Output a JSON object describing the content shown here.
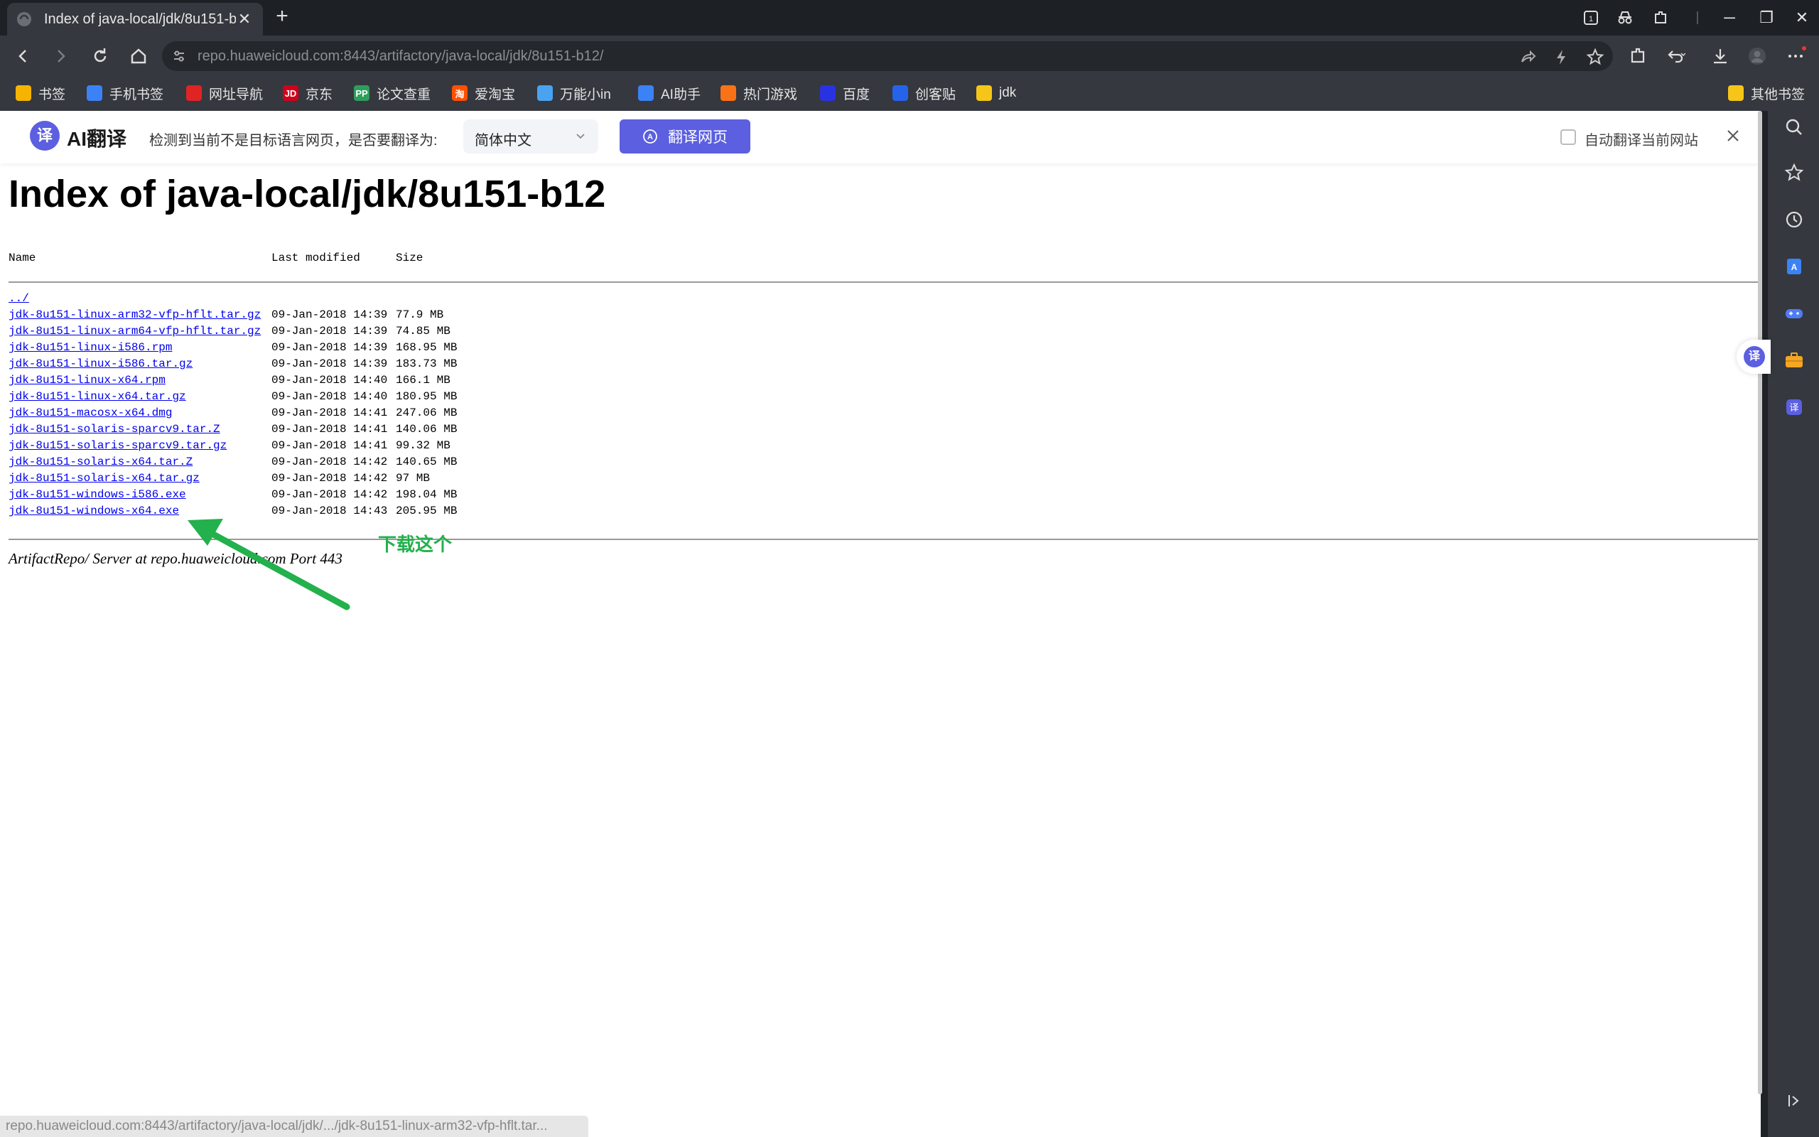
{
  "browser": {
    "tab_title": "Index of java-local/jdk/8u151-b",
    "url": "repo.huaweicloud.com:8443/artifactory/java-local/jdk/8u151-b12/",
    "status_url": "repo.huaweicloud.com:8443/artifactory/java-local/jdk/.../jdk-8u151-linux-arm32-vfp-hflt.tar..."
  },
  "bookmarks": [
    {
      "label": "书签",
      "icon": "star-icon",
      "color": "#f5b400"
    },
    {
      "label": "手机书签",
      "icon": "phone-bookmark-icon",
      "color": "#3b82f6"
    },
    {
      "label": "网址导航",
      "icon": "nav-site-icon",
      "color": "#e02424"
    },
    {
      "label": "京东",
      "icon": "jd-icon",
      "color": "#d0021b",
      "glyph": "JD"
    },
    {
      "label": "论文查重",
      "icon": "paper-check-icon",
      "color": "#2e9e5b",
      "glyph": "PP"
    },
    {
      "label": "爱淘宝",
      "icon": "taobao-icon",
      "color": "#ff5000",
      "glyph": "淘"
    },
    {
      "label": "万能小in",
      "icon": "xiaoin-icon",
      "color": "#4aa3f0"
    },
    {
      "label": "AI助手",
      "icon": "ai-assistant-icon",
      "color": "#3b82f6"
    },
    {
      "label": "热门游戏",
      "icon": "game-icon",
      "color": "#f97316"
    },
    {
      "label": "百度",
      "icon": "baidu-icon",
      "color": "#2932e1"
    },
    {
      "label": "创客贴",
      "icon": "chuangketie-icon",
      "color": "#2563eb"
    },
    {
      "label": "jdk",
      "icon": "folder-icon",
      "color": "#f5c518"
    }
  ],
  "other_bookmarks": "其他书签",
  "translate_bar": {
    "brand": "AI翻译",
    "logo_glyph": "译",
    "prompt": "检测到当前不是目标语言网页，是否要翻译为:",
    "language": "简体中文",
    "button": "翻译网页",
    "auto_label": "自动翻译当前网站"
  },
  "page": {
    "title": "Index of java-local/jdk/8u151-b12",
    "headers": {
      "name": "Name",
      "modified": "Last modified",
      "size": "Size"
    },
    "parent": "../",
    "files": [
      {
        "name": "jdk-8u151-linux-arm32-vfp-hflt.tar.gz",
        "date": "09-Jan-2018 14:39",
        "size": "77.9 MB"
      },
      {
        "name": "jdk-8u151-linux-arm64-vfp-hflt.tar.gz",
        "date": "09-Jan-2018 14:39",
        "size": "74.85 MB"
      },
      {
        "name": "jdk-8u151-linux-i586.rpm",
        "date": "09-Jan-2018 14:39",
        "size": "168.95 MB"
      },
      {
        "name": "jdk-8u151-linux-i586.tar.gz",
        "date": "09-Jan-2018 14:39",
        "size": "183.73 MB"
      },
      {
        "name": "jdk-8u151-linux-x64.rpm",
        "date": "09-Jan-2018 14:40",
        "size": "166.1 MB"
      },
      {
        "name": "jdk-8u151-linux-x64.tar.gz",
        "date": "09-Jan-2018 14:40",
        "size": "180.95 MB"
      },
      {
        "name": "jdk-8u151-macosx-x64.dmg",
        "date": "09-Jan-2018 14:41",
        "size": "247.06 MB"
      },
      {
        "name": "jdk-8u151-solaris-sparcv9.tar.Z",
        "date": "09-Jan-2018 14:41",
        "size": "140.06 MB"
      },
      {
        "name": "jdk-8u151-solaris-sparcv9.tar.gz",
        "date": "09-Jan-2018 14:41",
        "size": "99.32 MB"
      },
      {
        "name": "jdk-8u151-solaris-x64.tar.Z",
        "date": "09-Jan-2018 14:42",
        "size": "140.65 MB"
      },
      {
        "name": "jdk-8u151-solaris-x64.tar.gz",
        "date": "09-Jan-2018 14:42",
        "size": "97 MB"
      },
      {
        "name": "jdk-8u151-windows-i586.exe",
        "date": "09-Jan-2018 14:42",
        "size": "198.04 MB"
      },
      {
        "name": "jdk-8u151-windows-x64.exe",
        "date": "09-Jan-2018 14:43",
        "size": "205.95 MB"
      }
    ],
    "server_line": "ArtifactRepo/ Server at repo.huaweicloud.com Port 443",
    "annotation": "下载这个",
    "annotation_color": "#22b14c"
  },
  "colors": {
    "accent": "#5b5fe0",
    "link": "#0000ee",
    "chrome": "#35383e"
  }
}
